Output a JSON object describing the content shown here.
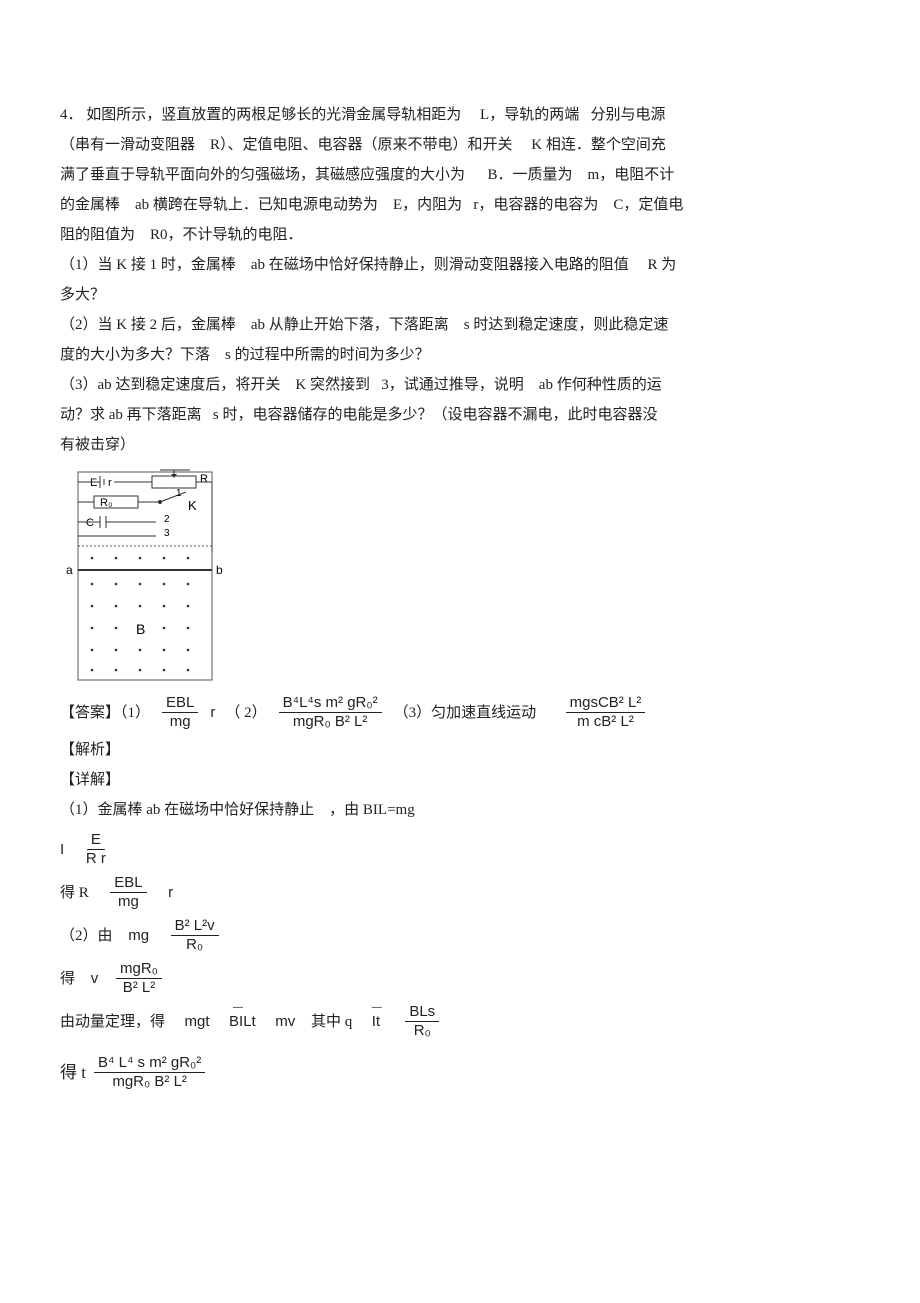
{
  "problem": {
    "number": "4．",
    "lines": {
      "l1a": "如图所示，竖直放置的两根足够长的光滑金属导轨相距为",
      "l1b": "L，导轨的两端",
      "l1c": "分别与电源",
      "l2a": "（串有一滑动变阻器",
      "l2b": "R）、定值电阻、电容器（原来不带电）和开关",
      "l2c": "K 相连．整个空间充",
      "l3a": "满了垂直于导轨平面向外的匀强磁场，其磁感应强度的大小为",
      "l3b": "B．一质量为",
      "l3c": "m，电阻不计",
      "l4a": "的金属棒",
      "l4b": "ab 横跨在导轨上．已知电源电动势为",
      "l4c": "E，内阻为",
      "l4d": "r，电容器的电容为",
      "l4e": "C，定值电",
      "l5a": "阻的阻值为",
      "l5b": "R0，不计导轨的电阻．",
      "q1a": "（1）当 K 接 1 时，金属棒",
      "q1b": "ab 在磁场中恰好保持静止，则滑动变阻器接入电路的阻值",
      "q1c": "R 为",
      "q1d": "多大？",
      "q2a": "（2）当 K 接 2 后，金属棒",
      "q2b": "ab 从静止开始下落，下落距离",
      "q2c": "s 时达到稳定速度，则此稳定速",
      "q2d": "度的大小为多大？下落",
      "q2e": "s 的过程中所需的时间为多少？",
      "q3a": "（3）ab 达到稳定速度后，将开关",
      "q3b": "K 突然接到",
      "q3c": "3，试通过推导，说明",
      "q3d": "ab 作何种性质的运",
      "q3e": "动？求 ab 再下落距离",
      "q3f": "s 时，电容器储存的电能是多少？（设电容器不漏电，此时电容器没",
      "q3g": "有被击穿）"
    }
  },
  "diagram": {
    "labels": {
      "E": "E",
      "r": "r",
      "R": "R",
      "R0": "R₀",
      "C": "C",
      "K": "K",
      "one": "1",
      "two": "2",
      "three": "3",
      "a": "a",
      "b": "b",
      "B": "B"
    }
  },
  "answer": {
    "label": "【答案】（1）",
    "a1_num": "EBL",
    "a1_den": "mg",
    "a1_tail": "r",
    "p2": "（ 2）",
    "a2_num": "B⁴L⁴s   m² gR₀²",
    "a2_den": "mgR₀ B² L²",
    "p3": "（3）匀加速直线运动",
    "a3_num": "mgsCB² L²",
    "a3_den": "m  cB² L²"
  },
  "solution": {
    "jiexi": "【解析】",
    "xiangjie": "【详解】",
    "s1a": "（1）金属棒 ab 在磁场中恰好保持静止",
    "s1b": "，由 BIL=mg",
    "eqI_lhs": "I",
    "eqI_num": "E",
    "eqI_den": "R  r",
    "getR_pre": "得 R",
    "getR_num": "EBL",
    "getR_den": "mg",
    "getR_tail": "r",
    "s2_pre": "（2）由",
    "s2_mg": "mg",
    "s2_num": "B² L²v",
    "s2_den": "R₀",
    "getv_pre": "得",
    "getv_v": "v",
    "getv_num": "mgR₀",
    "getv_den": "B² L²",
    "impulse_pre": "由动量定理，得",
    "impulse_a": "mgt",
    "impulse_b": "BILt",
    "impulse_c": "mv",
    "impulse_mid": "其中 q",
    "impulse_d": "It",
    "impulse_num": "BLs",
    "impulse_den": "R₀",
    "gett_pre": "得 t",
    "gett_num": "B⁴ L⁴ s m² gR₀²",
    "gett_den": "mgR₀ B² L²"
  }
}
